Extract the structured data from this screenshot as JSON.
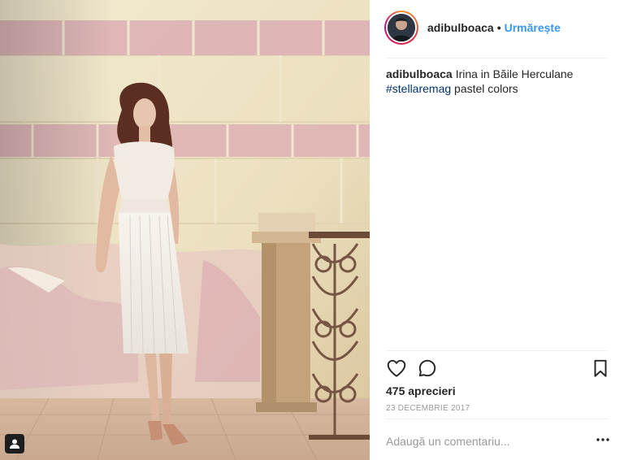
{
  "post": {
    "photo_alt": "Irina in Băile Herculane",
    "author": "adibulboaca",
    "separator": "•",
    "follow_label": "Urmărește",
    "caption_text": "Irina in Băile Herculane",
    "hashtag": "#stellaremag",
    "caption_tail": "pastel colors",
    "likes_label": "475 aprecieri",
    "date_label": "23 DECEMBRIE 2017",
    "comment_placeholder": "Adaugă un comentariu..."
  },
  "icons": {
    "like": "heart-icon",
    "comment": "comment-bubble-icon",
    "save": "bookmark-icon",
    "more": "more-options-icon",
    "tag": "user-tag-icon"
  },
  "colors": {
    "follow": "#3897f0",
    "hashtag": "#003569",
    "muted": "#999999",
    "text": "#262626"
  }
}
